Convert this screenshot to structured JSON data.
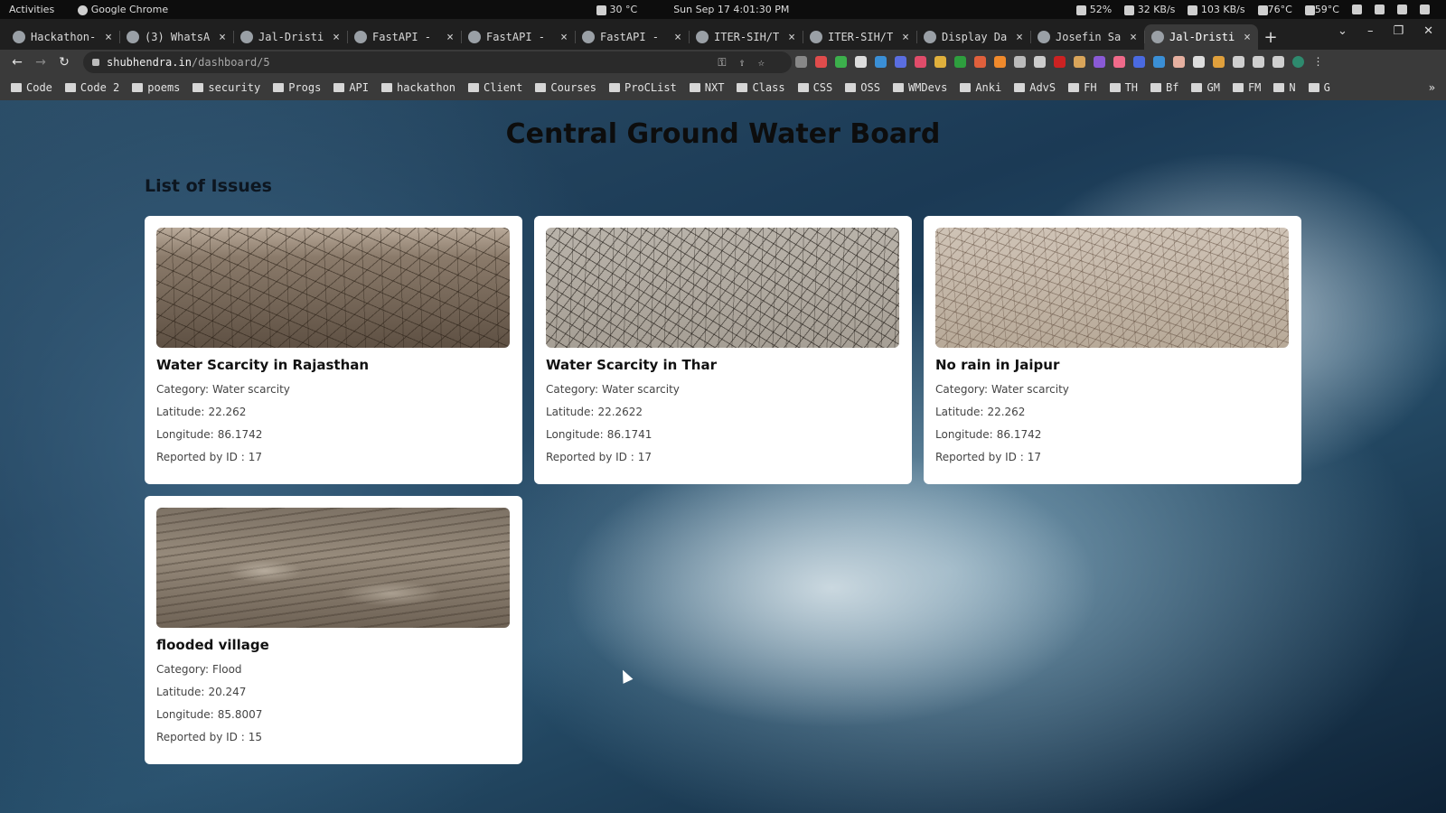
{
  "topbar": {
    "activities": "Activities",
    "app_name": "Google Chrome",
    "weather": "30 °C",
    "datetime": "Sun Sep 17  4:01:30 PM",
    "battery": "52%",
    "down_speed": "32 KB/s",
    "up_speed": "103 KB/s",
    "cpu_temp": "76°C",
    "gpu_temp": "59°C"
  },
  "tabs": [
    {
      "title": "Hackathon-",
      "icon": "github-icon"
    },
    {
      "title": "(3) WhatsA",
      "icon": "whatsapp-icon"
    },
    {
      "title": "Jal-Dristi",
      "icon": "globe-icon"
    },
    {
      "title": "FastAPI -",
      "icon": "fastapi-icon"
    },
    {
      "title": "FastAPI -",
      "icon": "fastapi-icon"
    },
    {
      "title": "FastAPI -",
      "icon": "fastapi-icon"
    },
    {
      "title": "ITER-SIH/T",
      "icon": "github-icon"
    },
    {
      "title": "ITER-SIH/T",
      "icon": "github-icon"
    },
    {
      "title": "Display Da",
      "icon": "chatgpt-icon"
    },
    {
      "title": "Josefin Sa",
      "icon": "google-fonts-icon"
    },
    {
      "title": "Jal-Dristi",
      "icon": "globe-icon",
      "active": true
    }
  ],
  "address": {
    "host": "shubhendra.in",
    "path": "/dashboard/5"
  },
  "bookmarks": [
    "Code",
    "Code 2",
    "poems",
    "security",
    "Progs",
    "API",
    "hackathon",
    "Client",
    "Courses",
    "ProCList",
    "NXT",
    "Class",
    "CSS",
    "OSS",
    "WMDevs",
    "Anki",
    "AdvS",
    "FH",
    "TH",
    "Bf",
    "GM",
    "FM",
    "N",
    "G"
  ],
  "page": {
    "title": "Central Ground Water Board",
    "section": "List of Issues",
    "labels": {
      "category": "Category:",
      "latitude": "Latitude:",
      "longitude": "Longitude:",
      "reported": "Reported by ID :"
    },
    "issues": [
      {
        "title": "Water Scarcity in Rajasthan",
        "category": "Water scarcity",
        "latitude": "22.262",
        "longitude": "86.1742",
        "reported_by": "17"
      },
      {
        "title": "Water Scarcity in Thar",
        "category": "Water scarcity",
        "latitude": "22.2622",
        "longitude": "86.1741",
        "reported_by": "17"
      },
      {
        "title": "No rain in Jaipur",
        "category": "Water scarcity",
        "latitude": "22.262",
        "longitude": "86.1742",
        "reported_by": "17"
      },
      {
        "title": "flooded village",
        "category": "Flood",
        "latitude": "20.247",
        "longitude": "85.8007",
        "reported_by": "15"
      }
    ]
  }
}
